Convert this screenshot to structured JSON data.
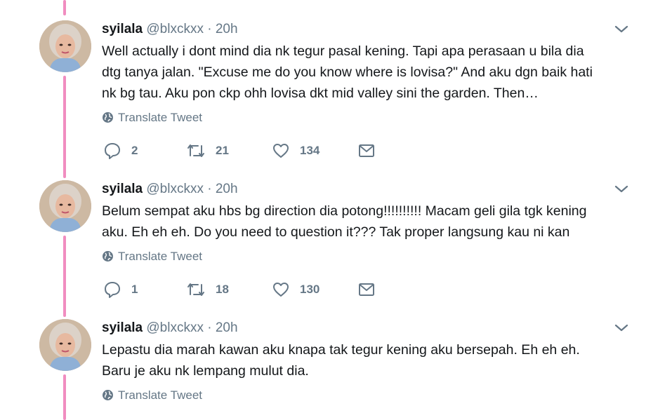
{
  "colors": {
    "thread_line": "#f08dc0",
    "text": "#14171a",
    "muted": "#657786"
  },
  "tweets": [
    {
      "name": "syilala",
      "handle": "@blxckxx",
      "separator": "·",
      "time": "20h",
      "lines": [
        "Well actually i dont mind dia nk tegur pasal kening. Tapi apa perasaan u bila dia",
        "dtg tanya jalan. \"Excuse me do you know where is lovisa?\" And aku dgn baik hati",
        "nk bg tau. Aku pon ckp ohh lovisa dkt mid valley sini the garden. Then…"
      ],
      "translate_label": "Translate Tweet",
      "replies": "2",
      "retweets": "21",
      "likes": "134"
    },
    {
      "name": "syilala",
      "handle": "@blxckxx",
      "separator": "·",
      "time": "20h",
      "lines": [
        "Belum sempat aku hbs bg direction dia potong!!!!!!!!!! Macam geli gila tgk kening",
        "aku. Eh eh eh. Do you need to question it??? Tak proper langsung kau ni kan"
      ],
      "translate_label": "Translate Tweet",
      "replies": "1",
      "retweets": "18",
      "likes": "130"
    },
    {
      "name": "syilala",
      "handle": "@blxckxx",
      "separator": "·",
      "time": "20h",
      "lines": [
        "Lepastu dia marah kawan aku knapa tak tegur kening aku bersepah. Eh eh eh.",
        "Baru je aku nk lempang mulut dia."
      ],
      "translate_label": "Translate Tweet"
    }
  ]
}
